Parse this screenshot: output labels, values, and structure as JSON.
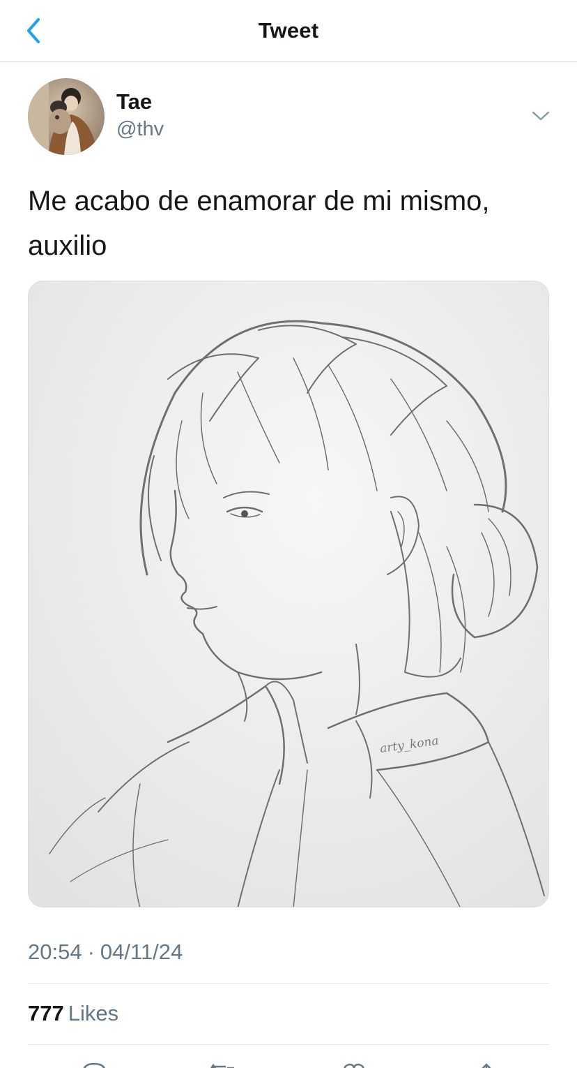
{
  "nav": {
    "title": "Tweet",
    "back_icon": "chevron-left-icon",
    "accent_color": "#1da1f2"
  },
  "tweet": {
    "display_name": "Tae",
    "handle": "@thv",
    "text": "Me acabo de enamorar de mi mismo, auxilio",
    "media_signature": "arty_kona",
    "time": "20:54",
    "separator": "·",
    "date": "04/11/24",
    "likes_count": "777",
    "likes_label": "Likes"
  },
  "actions": {
    "icons": [
      "reply-icon",
      "retweet-icon",
      "like-icon",
      "share-icon"
    ]
  }
}
